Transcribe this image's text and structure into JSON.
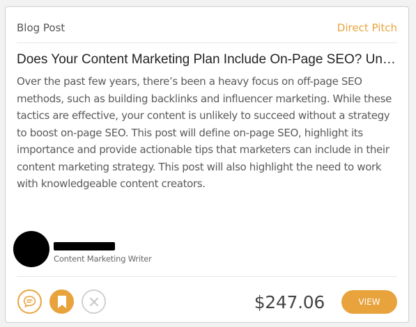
{
  "card": {
    "category": "Blog Post",
    "pitch_type": "Direct Pitch",
    "title": "Does Your Content Marketing Plan Include On-Page SEO? Understanding its Importance",
    "body": "Over the past few years, there’s been a heavy focus on off-page SEO methods, such as building backlinks and influencer marketing. While these tactics are effective, your content is unlikely to succeed without a strategy to boost on-page SEO. This post will define on-page SEO, highlight its importance and provide actionable tips that marketers can include in their content marketing strategy. This post will also highlight the need to work with knowledgeable content creators.",
    "author": {
      "name": "",
      "role": "Content Marketing Writer"
    },
    "price": "$247.06",
    "view_label": "VIEW"
  },
  "colors": {
    "accent": "#e8a33d",
    "muted": "#d0d0d0"
  },
  "icons": [
    "chat-bubble-icon",
    "bookmark-icon",
    "close-icon"
  ]
}
